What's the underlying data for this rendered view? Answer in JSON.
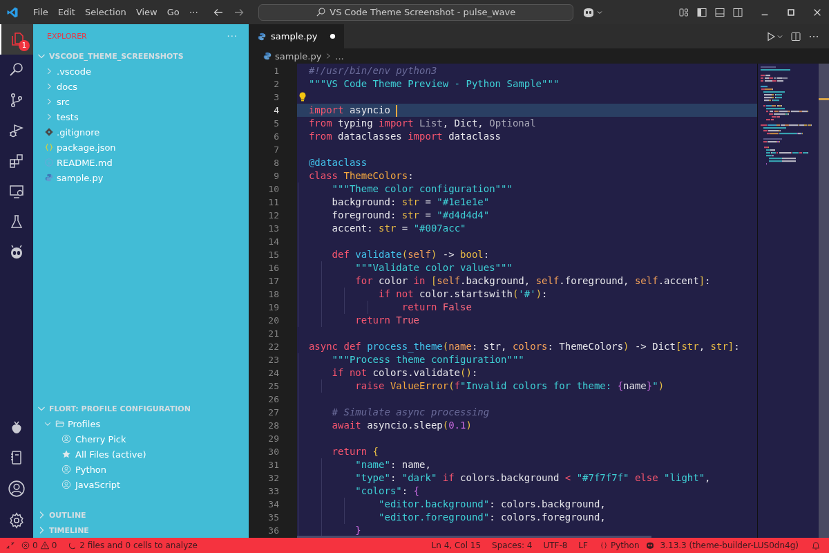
{
  "menu": [
    "File",
    "Edit",
    "Selection",
    "View",
    "Go",
    "⋯"
  ],
  "command_center": {
    "text": "VS Code Theme Screenshot - pulse_wave"
  },
  "activity_bar": [
    {
      "selected": true,
      "badge": "1"
    },
    {
      "selected": false
    },
    {
      "selected": false
    },
    {
      "selected": false
    },
    {
      "selected": false
    },
    {
      "selected": false
    },
    {
      "selected": false
    },
    {
      "selected": false
    },
    {
      "selected": false
    },
    {
      "selected": false
    }
  ],
  "sidebar": {
    "title": "EXPLORER",
    "more": "···",
    "root": {
      "label": "VSCODE_THEME_SCREENSHOTS",
      "expanded": true
    },
    "items": [
      {
        "kind": "folder",
        "label": ".vscode"
      },
      {
        "kind": "folder",
        "label": "docs"
      },
      {
        "kind": "folder",
        "label": "src"
      },
      {
        "kind": "folder",
        "label": "tests"
      },
      {
        "kind": "git",
        "label": ".gitignore"
      },
      {
        "kind": "json",
        "label": "package.json"
      },
      {
        "kind": "info",
        "label": "README.md"
      },
      {
        "kind": "python",
        "label": "sample.py"
      }
    ],
    "profile_section": {
      "label": "FLORT: PROFILE CONFIGURATION",
      "expanded": true,
      "group": {
        "label": "Profiles",
        "expanded": true
      },
      "items": [
        {
          "kind": "profile",
          "label": "Cherry Pick"
        },
        {
          "kind": "active",
          "label": "All Files (active)"
        },
        {
          "kind": "profile",
          "label": "Python"
        },
        {
          "kind": "profile",
          "label": "JavaScript"
        }
      ]
    },
    "collapsed_sections": [
      {
        "label": "OUTLINE",
        "expanded": false
      },
      {
        "label": "TIMELINE",
        "expanded": false
      }
    ]
  },
  "tabs": [
    {
      "label": "sample.py",
      "selected": true,
      "dirty": true
    }
  ],
  "breadcrumb": [
    "sample.py",
    "..."
  ],
  "editor": {
    "lines": [
      {
        "n": "1",
        "active": false,
        "tokens": [
          {
            "kind": "cm",
            "text": "#!/usr/bin/env python3"
          }
        ]
      },
      {
        "n": "2",
        "active": false,
        "tokens": [
          {
            "kind": "str",
            "text": "\"\"\"VS Code Theme Preview - Python Sample\"\"\""
          }
        ]
      },
      {
        "n": "3",
        "active": false,
        "bulb": true
      },
      {
        "n": "4",
        "active": true,
        "tokens": [
          {
            "kind": "kw",
            "text": "import"
          },
          {
            "kind": "p",
            "text": " asyncio"
          }
        ]
      },
      {
        "n": "5",
        "active": false,
        "tokens": [
          {
            "kind": "kw",
            "text": "from"
          },
          {
            "kind": "p",
            "text": " typing "
          },
          {
            "kind": "kw",
            "text": "import"
          },
          {
            "kind": "dim",
            "text": " List"
          },
          {
            "kind": "p",
            "text": ", Dict, "
          },
          {
            "kind": "dim",
            "text": "Optional"
          }
        ]
      },
      {
        "n": "6",
        "active": false,
        "tokens": [
          {
            "kind": "kw",
            "text": "from"
          },
          {
            "kind": "p",
            "text": " dataclasses "
          },
          {
            "kind": "kw",
            "text": "import"
          },
          {
            "kind": "p",
            "text": " dataclass"
          }
        ]
      },
      {
        "n": "7",
        "active": false
      },
      {
        "n": "8",
        "active": false,
        "tokens": [
          {
            "kind": "dec",
            "text": "@dataclass"
          }
        ]
      },
      {
        "n": "9",
        "active": false,
        "tokens": [
          {
            "kind": "kw",
            "text": "class "
          },
          {
            "kind": "cls",
            "text": "ThemeColors"
          },
          {
            "kind": "p",
            "text": ":"
          }
        ]
      },
      {
        "n": "10",
        "active": false,
        "tokens": [
          {
            "kind": "str",
            "text": "    \"\"\"Theme color configuration\"\"\""
          }
        ]
      },
      {
        "n": "11",
        "active": false,
        "tokens": [
          {
            "kind": "p",
            "text": "    background: "
          },
          {
            "kind": "ty",
            "text": "str"
          },
          {
            "kind": "p",
            "text": " = "
          },
          {
            "kind": "str",
            "text": "\"#1e1e1e\""
          }
        ]
      },
      {
        "n": "12",
        "active": false,
        "tokens": [
          {
            "kind": "p",
            "text": "    foreground: "
          },
          {
            "kind": "ty",
            "text": "str"
          },
          {
            "kind": "p",
            "text": " = "
          },
          {
            "kind": "str",
            "text": "\"#d4d4d4\""
          }
        ]
      },
      {
        "n": "13",
        "active": false,
        "tokens": [
          {
            "kind": "p",
            "text": "    accent: "
          },
          {
            "kind": "ty",
            "text": "str"
          },
          {
            "kind": "p",
            "text": " = "
          },
          {
            "kind": "str",
            "text": "\"#007acc\""
          }
        ]
      },
      {
        "n": "14",
        "active": false
      },
      {
        "n": "15",
        "active": false,
        "tokens": [
          {
            "kind": "kw",
            "text": "    def"
          },
          {
            "kind": "fn",
            "text": " validate"
          },
          {
            "kind": "br",
            "text": "("
          },
          {
            "kind": "self",
            "text": "self"
          },
          {
            "kind": "br",
            "text": ")"
          },
          {
            "kind": "p",
            "text": " -> "
          },
          {
            "kind": "ty",
            "text": "bool"
          },
          {
            "kind": "p",
            "text": ":"
          }
        ]
      },
      {
        "n": "16",
        "active": false,
        "tokens": [
          {
            "kind": "str",
            "text": "        \"\"\"Validate color values\"\"\""
          }
        ]
      },
      {
        "n": "17",
        "active": false,
        "tokens": [
          {
            "kind": "kw",
            "text": "        for"
          },
          {
            "kind": "p",
            "text": " color "
          },
          {
            "kind": "kw",
            "text": "in "
          },
          {
            "kind": "br",
            "text": "["
          },
          {
            "kind": "self",
            "text": "self"
          },
          {
            "kind": "p",
            "text": ".background, "
          },
          {
            "kind": "self",
            "text": "self"
          },
          {
            "kind": "p",
            "text": ".foreground, "
          },
          {
            "kind": "self",
            "text": "self"
          },
          {
            "kind": "p",
            "text": ".accent"
          },
          {
            "kind": "br",
            "text": "]"
          },
          {
            "kind": "p",
            "text": ":"
          }
        ]
      },
      {
        "n": "18",
        "active": false,
        "tokens": [
          {
            "kind": "kw",
            "text": "            if not"
          },
          {
            "kind": "p",
            "text": " color.startswith"
          },
          {
            "kind": "br",
            "text": "("
          },
          {
            "kind": "str",
            "text": "'#'"
          },
          {
            "kind": "br",
            "text": ")"
          },
          {
            "kind": "p",
            "text": ":"
          }
        ]
      },
      {
        "n": "19",
        "active": false,
        "tokens": [
          {
            "kind": "kw",
            "text": "                return"
          },
          {
            "kind": "bool",
            "text": " False"
          }
        ]
      },
      {
        "n": "20",
        "active": false,
        "tokens": [
          {
            "kind": "kw",
            "text": "        return"
          },
          {
            "kind": "bool",
            "text": " True"
          }
        ]
      },
      {
        "n": "21",
        "active": false
      },
      {
        "n": "22",
        "active": false,
        "tokens": [
          {
            "kind": "kw",
            "text": "async def"
          },
          {
            "kind": "fn",
            "text": " process_theme"
          },
          {
            "kind": "br",
            "text": "("
          },
          {
            "kind": "par",
            "text": "name"
          },
          {
            "kind": "p",
            "text": ": str, "
          },
          {
            "kind": "par",
            "text": "colors"
          },
          {
            "kind": "p",
            "text": ": ThemeColors"
          },
          {
            "kind": "br",
            "text": ")"
          },
          {
            "kind": "p",
            "text": " -> Dict"
          },
          {
            "kind": "br",
            "text": "["
          },
          {
            "kind": "ty",
            "text": "str"
          },
          {
            "kind": "p",
            "text": ", "
          },
          {
            "kind": "ty",
            "text": "str"
          },
          {
            "kind": "br",
            "text": "]"
          },
          {
            "kind": "p",
            "text": ":"
          }
        ]
      },
      {
        "n": "23",
        "active": false,
        "tokens": [
          {
            "kind": "str",
            "text": "    \"\"\"Process theme configuration\"\"\""
          }
        ]
      },
      {
        "n": "24",
        "active": false,
        "tokens": [
          {
            "kind": "kw",
            "text": "    if not"
          },
          {
            "kind": "p",
            "text": " colors.validate"
          },
          {
            "kind": "br",
            "text": "()"
          },
          {
            "kind": "p",
            "text": ":"
          }
        ]
      },
      {
        "n": "25",
        "active": false,
        "tokens": [
          {
            "kind": "kw",
            "text": "        raise "
          },
          {
            "kind": "cls",
            "text": "ValueError"
          },
          {
            "kind": "br",
            "text": "("
          },
          {
            "kind": "kw",
            "text": "f"
          },
          {
            "kind": "str",
            "text": "\"Invalid colors for theme: "
          },
          {
            "kind": "fv",
            "text": "{"
          },
          {
            "kind": "p",
            "text": "name"
          },
          {
            "kind": "fv",
            "text": "}"
          },
          {
            "kind": "str",
            "text": "\""
          },
          {
            "kind": "br",
            "text": ")"
          }
        ]
      },
      {
        "n": "26",
        "active": false
      },
      {
        "n": "27",
        "active": false,
        "tokens": [
          {
            "kind": "cm",
            "text": "    # Simulate async processing"
          }
        ]
      },
      {
        "n": "28",
        "active": false,
        "tokens": [
          {
            "kind": "kw",
            "text": "    await"
          },
          {
            "kind": "p",
            "text": " asyncio.sleep"
          },
          {
            "kind": "br",
            "text": "("
          },
          {
            "kind": "num",
            "text": "0.1"
          },
          {
            "kind": "br",
            "text": ")"
          }
        ]
      },
      {
        "n": "29",
        "active": false
      },
      {
        "n": "30",
        "active": false,
        "tokens": [
          {
            "kind": "kw",
            "text": "    return "
          },
          {
            "kind": "br",
            "text": "{"
          }
        ]
      },
      {
        "n": "31",
        "active": false,
        "tokens": [
          {
            "kind": "str",
            "text": "        \"name\""
          },
          {
            "kind": "p",
            "text": ": name,"
          }
        ]
      },
      {
        "n": "32",
        "active": false,
        "tokens": [
          {
            "kind": "str",
            "text": "        \"type\""
          },
          {
            "kind": "p",
            "text": ": "
          },
          {
            "kind": "str",
            "text": "\"dark\""
          },
          {
            "kind": "kw",
            "text": " if"
          },
          {
            "kind": "p",
            "text": " colors.background "
          },
          {
            "kind": "kw",
            "text": "<"
          },
          {
            "kind": "str",
            "text": " \"#7f7f7f\""
          },
          {
            "kind": "kw",
            "text": " else"
          },
          {
            "kind": "str",
            "text": " \"light\""
          },
          {
            "kind": "p",
            "text": ","
          }
        ]
      },
      {
        "n": "33",
        "active": false,
        "tokens": [
          {
            "kind": "str",
            "text": "        \"colors\""
          },
          {
            "kind": "p",
            "text": ": "
          },
          {
            "kind": "fv",
            "text": "{"
          }
        ]
      },
      {
        "n": "34",
        "active": false,
        "tokens": [
          {
            "kind": "str",
            "text": "            \"editor.background\""
          },
          {
            "kind": "p",
            "text": ": colors.background,"
          }
        ]
      },
      {
        "n": "35",
        "active": false,
        "tokens": [
          {
            "kind": "str",
            "text": "            \"editor.foreground\""
          },
          {
            "kind": "p",
            "text": ": colors.foreground,"
          }
        ]
      },
      {
        "n": "36",
        "active": false,
        "tokens": [
          {
            "kind": "fv",
            "text": "        }"
          }
        ]
      }
    ]
  },
  "status_bar": {
    "errors": "0",
    "warnings": "0",
    "analysis": "2 files and 0 cells to analyze",
    "cursor": "Ln 4, Col 15",
    "indent": "Spaces: 4",
    "encoding": "UTF-8",
    "eol": "LF",
    "language": "Python",
    "interpreter": "3.13.3 (theme-builder-LUS0dn4g)"
  }
}
